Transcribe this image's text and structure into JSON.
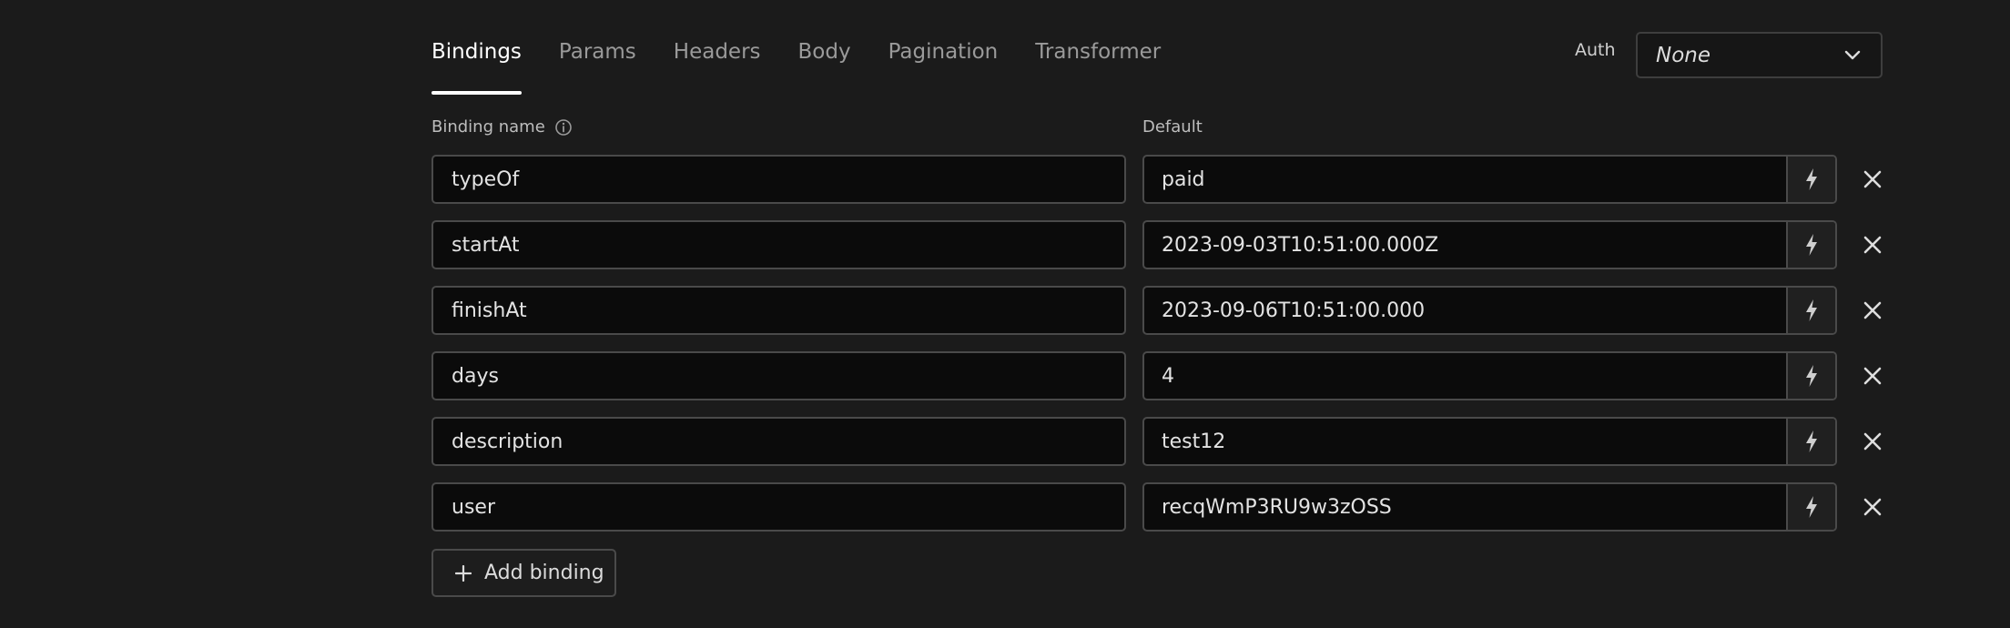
{
  "tabs": [
    {
      "label": "Bindings",
      "active": true
    },
    {
      "label": "Params",
      "active": false
    },
    {
      "label": "Headers",
      "active": false
    },
    {
      "label": "Body",
      "active": false
    },
    {
      "label": "Pagination",
      "active": false
    },
    {
      "label": "Transformer",
      "active": false
    }
  ],
  "auth": {
    "label": "Auth",
    "value": "None"
  },
  "columns": {
    "name": "Binding name",
    "default": "Default"
  },
  "bindings": [
    {
      "name": "typeOf",
      "default": "paid"
    },
    {
      "name": "startAt",
      "default": "2023-09-03T10:51:00.000Z"
    },
    {
      "name": "finishAt",
      "default": "2023-09-06T10:51:00.000"
    },
    {
      "name": "days",
      "default": "4"
    },
    {
      "name": "description",
      "default": "test12"
    },
    {
      "name": "user",
      "default": "recqWmP3RU9w3zOSS"
    }
  ],
  "add_button": {
    "label": "Add binding"
  },
  "icons": {
    "info": "info-icon",
    "chevron": "chevron-down-icon",
    "bolt": "lightning-bolt-icon",
    "remove": "close-icon",
    "add": "plus-icon"
  }
}
